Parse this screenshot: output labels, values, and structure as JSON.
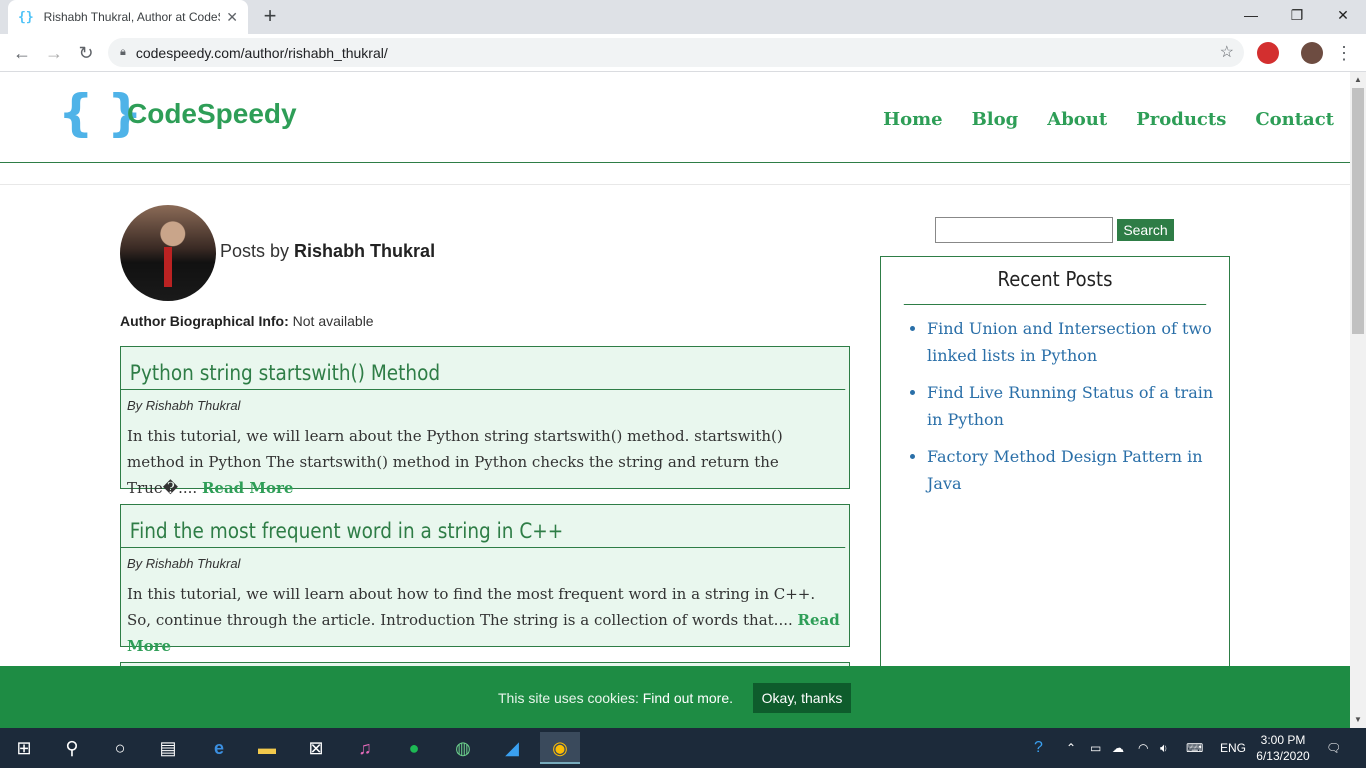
{
  "browser": {
    "tab_title": "Rishabh Thukral, Author at CodeS",
    "favicon": "{}",
    "url": "codespeedy.com/author/rishabh_thukral/"
  },
  "site": {
    "logo_braces": "{ }",
    "logo_text": "CodeSpeedy",
    "nav": [
      "Home",
      "Blog",
      "About",
      "Products",
      "Contact"
    ]
  },
  "author": {
    "posts_by_prefix": "Posts by",
    "name": "Rishabh Thukral",
    "bio_label": "Author Biographical Info:",
    "bio_value": "Not available"
  },
  "posts": [
    {
      "title": "Python string startswith() Method",
      "byline": "By Rishabh Thukral",
      "excerpt": "In this tutorial, we will learn about the Python string startswith() method. startswith() method in Python The startswith() method in Python checks the string and return the True�....",
      "read_more": "Read More"
    },
    {
      "title": "Find the most frequent word in a string in C++",
      "byline": "By Rishabh Thukral",
      "excerpt": "In this tutorial, we will learn about how to find the most frequent word in a string in C++. So, continue through the article. Introduction The string is a collection of words that....",
      "read_more": "Read More"
    }
  ],
  "sidebar": {
    "search_button": "Search",
    "search_value": "",
    "recent_title": "Recent Posts",
    "recent_posts": [
      "Find Union and Intersection of two linked lists in Python",
      "Find Live Running Status of a train in Python",
      "Factory Method Design Pattern in Java"
    ]
  },
  "cookie": {
    "message": "This site uses cookies:",
    "link": "Find out more.",
    "button": "Okay, thanks"
  },
  "taskbar": {
    "language": "ENG",
    "time": "3:00 PM",
    "date": "6/13/2020"
  }
}
